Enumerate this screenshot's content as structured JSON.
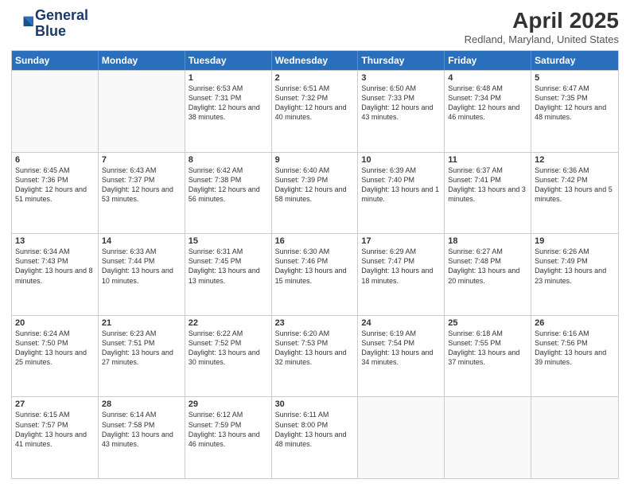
{
  "logo": {
    "line1": "General",
    "line2": "Blue"
  },
  "title": {
    "month_year": "April 2025",
    "location": "Redland, Maryland, United States"
  },
  "days_of_week": [
    "Sunday",
    "Monday",
    "Tuesday",
    "Wednesday",
    "Thursday",
    "Friday",
    "Saturday"
  ],
  "weeks": [
    [
      {
        "day": "",
        "info": ""
      },
      {
        "day": "",
        "info": ""
      },
      {
        "day": "1",
        "info": "Sunrise: 6:53 AM\nSunset: 7:31 PM\nDaylight: 12 hours and 38 minutes."
      },
      {
        "day": "2",
        "info": "Sunrise: 6:51 AM\nSunset: 7:32 PM\nDaylight: 12 hours and 40 minutes."
      },
      {
        "day": "3",
        "info": "Sunrise: 6:50 AM\nSunset: 7:33 PM\nDaylight: 12 hours and 43 minutes."
      },
      {
        "day": "4",
        "info": "Sunrise: 6:48 AM\nSunset: 7:34 PM\nDaylight: 12 hours and 46 minutes."
      },
      {
        "day": "5",
        "info": "Sunrise: 6:47 AM\nSunset: 7:35 PM\nDaylight: 12 hours and 48 minutes."
      }
    ],
    [
      {
        "day": "6",
        "info": "Sunrise: 6:45 AM\nSunset: 7:36 PM\nDaylight: 12 hours and 51 minutes."
      },
      {
        "day": "7",
        "info": "Sunrise: 6:43 AM\nSunset: 7:37 PM\nDaylight: 12 hours and 53 minutes."
      },
      {
        "day": "8",
        "info": "Sunrise: 6:42 AM\nSunset: 7:38 PM\nDaylight: 12 hours and 56 minutes."
      },
      {
        "day": "9",
        "info": "Sunrise: 6:40 AM\nSunset: 7:39 PM\nDaylight: 12 hours and 58 minutes."
      },
      {
        "day": "10",
        "info": "Sunrise: 6:39 AM\nSunset: 7:40 PM\nDaylight: 13 hours and 1 minute."
      },
      {
        "day": "11",
        "info": "Sunrise: 6:37 AM\nSunset: 7:41 PM\nDaylight: 13 hours and 3 minutes."
      },
      {
        "day": "12",
        "info": "Sunrise: 6:36 AM\nSunset: 7:42 PM\nDaylight: 13 hours and 5 minutes."
      }
    ],
    [
      {
        "day": "13",
        "info": "Sunrise: 6:34 AM\nSunset: 7:43 PM\nDaylight: 13 hours and 8 minutes."
      },
      {
        "day": "14",
        "info": "Sunrise: 6:33 AM\nSunset: 7:44 PM\nDaylight: 13 hours and 10 minutes."
      },
      {
        "day": "15",
        "info": "Sunrise: 6:31 AM\nSunset: 7:45 PM\nDaylight: 13 hours and 13 minutes."
      },
      {
        "day": "16",
        "info": "Sunrise: 6:30 AM\nSunset: 7:46 PM\nDaylight: 13 hours and 15 minutes."
      },
      {
        "day": "17",
        "info": "Sunrise: 6:29 AM\nSunset: 7:47 PM\nDaylight: 13 hours and 18 minutes."
      },
      {
        "day": "18",
        "info": "Sunrise: 6:27 AM\nSunset: 7:48 PM\nDaylight: 13 hours and 20 minutes."
      },
      {
        "day": "19",
        "info": "Sunrise: 6:26 AM\nSunset: 7:49 PM\nDaylight: 13 hours and 23 minutes."
      }
    ],
    [
      {
        "day": "20",
        "info": "Sunrise: 6:24 AM\nSunset: 7:50 PM\nDaylight: 13 hours and 25 minutes."
      },
      {
        "day": "21",
        "info": "Sunrise: 6:23 AM\nSunset: 7:51 PM\nDaylight: 13 hours and 27 minutes."
      },
      {
        "day": "22",
        "info": "Sunrise: 6:22 AM\nSunset: 7:52 PM\nDaylight: 13 hours and 30 minutes."
      },
      {
        "day": "23",
        "info": "Sunrise: 6:20 AM\nSunset: 7:53 PM\nDaylight: 13 hours and 32 minutes."
      },
      {
        "day": "24",
        "info": "Sunrise: 6:19 AM\nSunset: 7:54 PM\nDaylight: 13 hours and 34 minutes."
      },
      {
        "day": "25",
        "info": "Sunrise: 6:18 AM\nSunset: 7:55 PM\nDaylight: 13 hours and 37 minutes."
      },
      {
        "day": "26",
        "info": "Sunrise: 6:16 AM\nSunset: 7:56 PM\nDaylight: 13 hours and 39 minutes."
      }
    ],
    [
      {
        "day": "27",
        "info": "Sunrise: 6:15 AM\nSunset: 7:57 PM\nDaylight: 13 hours and 41 minutes."
      },
      {
        "day": "28",
        "info": "Sunrise: 6:14 AM\nSunset: 7:58 PM\nDaylight: 13 hours and 43 minutes."
      },
      {
        "day": "29",
        "info": "Sunrise: 6:12 AM\nSunset: 7:59 PM\nDaylight: 13 hours and 46 minutes."
      },
      {
        "day": "30",
        "info": "Sunrise: 6:11 AM\nSunset: 8:00 PM\nDaylight: 13 hours and 48 minutes."
      },
      {
        "day": "",
        "info": ""
      },
      {
        "day": "",
        "info": ""
      },
      {
        "day": "",
        "info": ""
      }
    ]
  ]
}
